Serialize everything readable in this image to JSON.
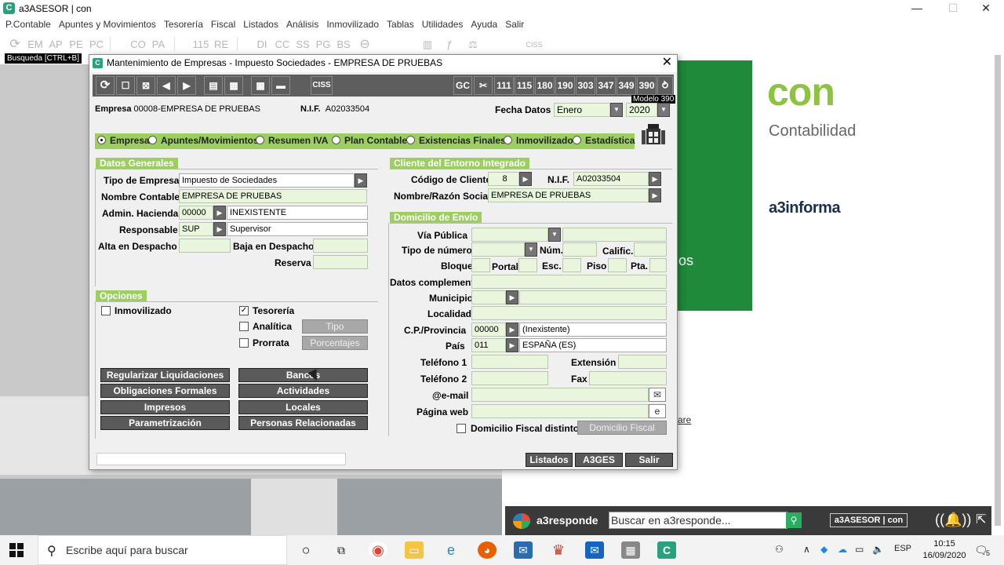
{
  "window": {
    "title": "a3ASESOR | con",
    "minimize": "—",
    "maximize": "☐",
    "close": "✕"
  },
  "menu": [
    "P.Contable",
    "Apuntes y Movimientos",
    "Tesorería",
    "Fiscal",
    "Listados",
    "Análisis",
    "Inmovilizado",
    "Tablas",
    "Utilidades",
    "Ayuda",
    "Salir"
  ],
  "toolbar": {
    "buttons": [
      "EM",
      "AP",
      "PE",
      "PC",
      "CO",
      "PA",
      "115",
      "RE",
      "DI",
      "CC",
      "SS",
      "PG",
      "BS"
    ],
    "ciss": "CISS",
    "search_hint": "Busqueda [CTRL+B]"
  },
  "dialog": {
    "title": "Mantenimiento de Empresas - Impuesto Sociedades - EMPRESA DE PRUEBAS",
    "close": "✕",
    "toolbar": {
      "ciss": "CISS",
      "gc": "GC",
      "models": [
        "111",
        "115",
        "180",
        "190",
        "303",
        "347",
        "349",
        "390"
      ],
      "tooltip": "Modelo 390"
    },
    "header": {
      "empresa_label": "Empresa",
      "empresa_value": "00008-EMPRESA DE PRUEBAS",
      "nif_label": "N.I.F.",
      "nif_value": "A02033504",
      "fecha_label": "Fecha Datos",
      "month": "Enero",
      "year": "2020"
    },
    "tabs": [
      {
        "label": "Empresa",
        "selected": true
      },
      {
        "label": "Apuntes/Movimientos",
        "selected": false
      },
      {
        "label": "Resumen IVA",
        "selected": false
      },
      {
        "label": "Plan Contable",
        "selected": false
      },
      {
        "label": "Existencias Finales",
        "selected": false
      },
      {
        "label": "Inmovilizado",
        "selected": false
      },
      {
        "label": "Estadística",
        "selected": false
      }
    ],
    "datos_generales": {
      "header": "Datos Generales",
      "tipo_empresa_label": "Tipo de Empresa",
      "tipo_empresa_value": "Impuesto de Sociedades",
      "nombre_contable_label": "Nombre Contable",
      "nombre_contable_value": "EMPRESA DE PRUEBAS",
      "admin_hacienda_label": "Admin. Hacienda",
      "admin_hacienda_code": "00000",
      "admin_hacienda_value": "INEXISTENTE",
      "responsable_label": "Responsable",
      "responsable_code": "SUP",
      "responsable_value": "Supervisor",
      "alta_label": "Alta en Despacho",
      "baja_label": "Baja en Despacho",
      "reserva_label": "Reserva"
    },
    "opciones": {
      "header": "Opciones",
      "inmovilizado": {
        "label": "Inmovilizado",
        "checked": false
      },
      "tesoreria": {
        "label": "Tesorería",
        "checked": true
      },
      "analitica": {
        "label": "Analítica",
        "checked": false
      },
      "prorrata": {
        "label": "Prorrata",
        "checked": false
      },
      "tipo_button": "Tipo",
      "porcentajes_button": "Porcentajes"
    },
    "action_buttons": {
      "regularizar": "Regularizar Liquidaciones",
      "bancos": "Bancos",
      "obligaciones": "Obligaciones Formales",
      "actividades": "Actividades",
      "impresos": "Impresos",
      "locales": "Locales",
      "parametrizacion": "Parametrización",
      "personas": "Personas Relacionadas"
    },
    "cliente": {
      "header": "Cliente del Entorno Integrado",
      "codigo_label": "Código de Cliente",
      "codigo_value": "8",
      "nif_label": "N.I.F.",
      "nif_value": "A02033504",
      "nombre_label": "Nombre/Razón Social",
      "nombre_value": "EMPRESA DE PRUEBAS"
    },
    "domicilio": {
      "header": "Domicilio de Envío",
      "via_publica": "Vía Pública",
      "tipo_numero": "Tipo de número",
      "num": "Núm.",
      "calific": "Calific.",
      "bloque": "Bloque",
      "portal": "Portal",
      "esc": "Esc.",
      "piso": "Piso",
      "pta": "Pta.",
      "datos_compl": "Datos complement.",
      "municipio": "Municipio",
      "localidad": "Localidad",
      "cp_label": "C.P./Provincia",
      "cp_code": "00000",
      "cp_value": "(Inexistente)",
      "pais_label": "País",
      "pais_code": "011",
      "pais_value": "ESPAÑA (ES)",
      "telefono1": "Teléfono 1",
      "extension": "Extensión",
      "telefono2": "Teléfono 2",
      "fax": "Fax",
      "email": "@e-mail",
      "web": "Página web",
      "fiscal_distinto": "Domicilio Fiscal distinto",
      "fiscal_button": "Domicilio Fiscal"
    },
    "footer": {
      "listados": "Listados",
      "a3ges": "A3GES",
      "salir": "Salir"
    }
  },
  "background": {
    "brand": "con",
    "subtitle": "Contabilidad",
    "company": "a3informa",
    "partial_text": "os",
    "partial_link": "are"
  },
  "a3responde": {
    "label": "a3responde",
    "search_placeholder": "Buscar en a3responde...",
    "product": "a3ASESOR | con"
  },
  "taskbar": {
    "search_placeholder": "Escribe aquí para buscar",
    "lang": "ESP",
    "time": "10:15",
    "date": "16/09/2020",
    "notifications": "5"
  }
}
